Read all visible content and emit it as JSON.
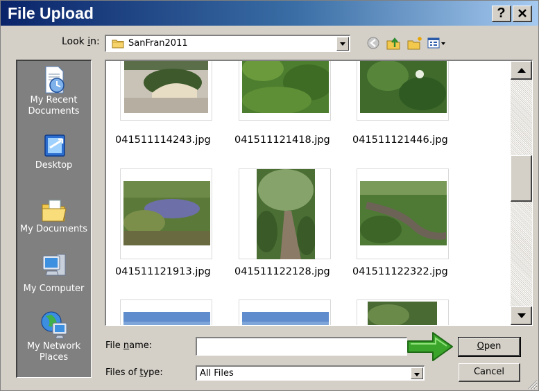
{
  "window": {
    "title": "File Upload",
    "help_button": "?"
  },
  "lookin": {
    "label_prefix": "Look ",
    "label_mnemonic": "i",
    "label_suffix": "n:",
    "value": "SanFran2011"
  },
  "toolbar": {
    "back": "back-icon",
    "up": "up-folder-icon",
    "new_folder": "new-folder-icon",
    "views": "views-menu-icon"
  },
  "places": [
    {
      "label": "My Recent Documents",
      "icon": "recent-documents-icon"
    },
    {
      "label": "Desktop",
      "icon": "desktop-icon"
    },
    {
      "label": "My Documents",
      "icon": "my-documents-icon"
    },
    {
      "label": "My Computer",
      "icon": "my-computer-icon"
    },
    {
      "label": "My Network Places",
      "icon": "network-places-icon"
    }
  ],
  "files": [
    {
      "name": "041511114243.jpg"
    },
    {
      "name": "041511121418.jpg"
    },
    {
      "name": "041511121446.jpg"
    },
    {
      "name": "041511121913.jpg"
    },
    {
      "name": "041511122128.jpg"
    },
    {
      "name": "041511122322.jpg"
    }
  ],
  "filename": {
    "label_prefix": "File ",
    "label_mnemonic": "n",
    "label_suffix": "ame:",
    "value": "",
    "placeholder": ""
  },
  "filetype": {
    "label_prefix": "Files of ",
    "label_mnemonic": "t",
    "label_suffix": "ype:",
    "value": "All Files"
  },
  "buttons": {
    "open_mnemonic": "O",
    "open_rest": "pen",
    "cancel": "Cancel"
  },
  "colors": {
    "title_start": "#0a246a",
    "title_end": "#a6caf0",
    "face": "#d4d0c8",
    "places_bg": "#808080",
    "arrow": "#3aa52a"
  }
}
